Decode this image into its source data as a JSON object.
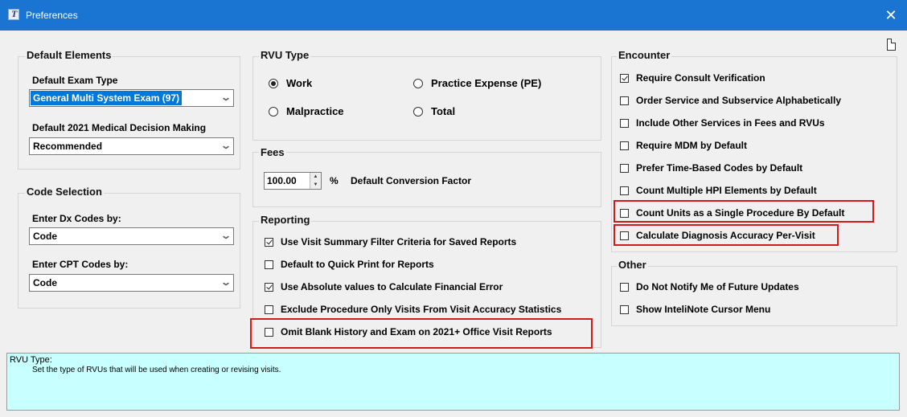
{
  "window": {
    "title": "Preferences",
    "app_icon_letter": "T",
    "close_glyph": "✕"
  },
  "default_elements": {
    "title": "Default Elements",
    "exam_type_label": "Default Exam Type",
    "exam_type_value": "General Multi System Exam (97)",
    "mdm_label": "Default 2021 Medical Decision Making",
    "mdm_value": "Recommended"
  },
  "code_selection": {
    "title": "Code Selection",
    "dx_label": "Enter Dx Codes by:",
    "dx_value": "Code",
    "cpt_label": "Enter CPT Codes by:",
    "cpt_value": "Code"
  },
  "rvu_type": {
    "title": "RVU Type",
    "options": [
      "Work",
      "Practice Expense (PE)",
      "Malpractice",
      "Total"
    ],
    "selected": "Work"
  },
  "fees": {
    "title": "Fees",
    "conversion_value": "100.00",
    "percent_sign": "%",
    "conversion_label": "Default Conversion Factor"
  },
  "reporting": {
    "title": "Reporting",
    "items": [
      {
        "label": "Use Visit Summary Filter Criteria for Saved Reports",
        "checked": true
      },
      {
        "label": "Default to Quick Print for Reports",
        "checked": false
      },
      {
        "label": "Use Absolute values to Calculate Financial Error",
        "checked": true
      },
      {
        "label": "Exclude Procedure Only Visits From Visit Accuracy Statistics",
        "checked": false
      },
      {
        "label": "Omit Blank History and Exam on 2021+ Office Visit Reports",
        "checked": false
      }
    ]
  },
  "encounter": {
    "title": "Encounter",
    "items": [
      {
        "label": "Require Consult Verification",
        "checked": true
      },
      {
        "label": "Order Service and Subservice Alphabetically",
        "checked": false
      },
      {
        "label": "Include Other Services in Fees and RVUs",
        "checked": false
      },
      {
        "label": "Require MDM by Default",
        "checked": false
      },
      {
        "label": "Prefer Time-Based Codes by Default",
        "checked": false
      },
      {
        "label": "Count Multiple HPI Elements by Default",
        "checked": false
      },
      {
        "label": "Count Units as a Single Procedure By Default",
        "checked": false
      },
      {
        "label": "Calculate Diagnosis Accuracy Per-Visit",
        "checked": false
      }
    ]
  },
  "other": {
    "title": "Other",
    "items": [
      {
        "label": "Do Not Notify Me of Future Updates",
        "checked": false
      },
      {
        "label": "Show InteliNote Cursor Menu",
        "checked": false
      }
    ]
  },
  "description": {
    "title": "RVU Type:",
    "text": "Set the type of RVUs that will be used when creating or revising visits."
  },
  "colors": {
    "title_bar": "#1a75d2",
    "highlight": "#d11a1a",
    "description_bg": "#c8ffff"
  }
}
